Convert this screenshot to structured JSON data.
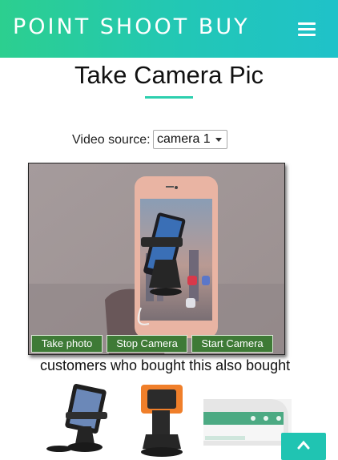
{
  "header": {
    "brand": "POINT SHOOT BUY",
    "menu_icon": "hamburger-menu-icon",
    "gradient": [
      "#2ccf8f",
      "#1fc2c9"
    ]
  },
  "page": {
    "title": "Take Camera Pic"
  },
  "camera": {
    "source_label": "Video source:",
    "source_selected": "camera 1",
    "buttons": {
      "take_photo": "Take photo",
      "stop_camera": "Stop Camera",
      "start_camera": "Start Camera"
    },
    "button_color": "#3e7a36"
  },
  "recommendations": {
    "heading": "customers who bought this also bought",
    "products": [
      {
        "icon": "phone-car-mount-black-icon"
      },
      {
        "icon": "phone-car-mount-orange-icon"
      },
      {
        "icon": "phone-screen-thumbnail-icon"
      }
    ]
  },
  "scroll_top": {
    "icon": "chevron-up-icon",
    "color": "#20c4b2"
  }
}
